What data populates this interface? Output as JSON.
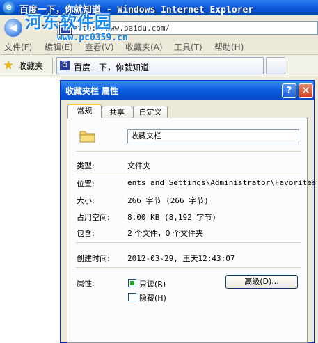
{
  "window": {
    "title": "百度一下，你就知道 - Windows Internet Explorer",
    "logo_glyph": "e",
    "address": "http://www.baidu.com/",
    "favicon_glyph": "百"
  },
  "watermark": {
    "name": "河东软件园",
    "url": "www.pc0359.cn"
  },
  "menu": [
    "文件(F)",
    "编辑(E)",
    "查看(V)",
    "收藏夹(A)",
    "工具(T)",
    "帮助(H)"
  ],
  "favorites_bar": {
    "label": "收藏夹",
    "tab_title": "百度一下，你就知道"
  },
  "dialog": {
    "title": "收藏夹栏 属性",
    "help_glyph": "?",
    "close_glyph": "✕",
    "tabs": [
      "常规",
      "共享",
      "自定义"
    ],
    "folder_name": "收藏夹栏",
    "properties": [
      {
        "label": "类型:",
        "value": "文件夹"
      },
      {
        "label": "位置:",
        "value": "ents and Settings\\Administrator\\Favorites"
      },
      {
        "label": "大小:",
        "value": "266 字节 (266 字节)"
      },
      {
        "label": "占用空间:",
        "value": "8.00 KB (8,192 字节)"
      },
      {
        "label": "包含:",
        "value": "2 个文件，0 个文件夹"
      }
    ],
    "created": {
      "label": "创建时间:",
      "value": "2012-03-29, 王天12:43:07"
    },
    "attributes": {
      "label": "属性:",
      "readonly": {
        "label": "只读(R)",
        "checked": true
      },
      "hidden": {
        "label": "隐藏(H)",
        "checked": false
      },
      "advanced_button": "高级(D)..."
    }
  }
}
